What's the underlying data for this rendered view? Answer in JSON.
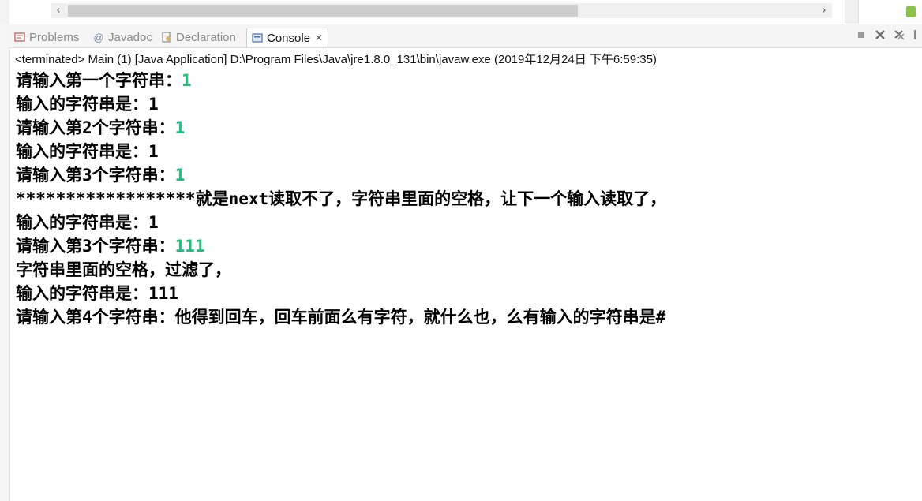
{
  "editor": {
    "hscroll_left_arrow": "‹",
    "hscroll_right_arrow": "›"
  },
  "tabs": [
    {
      "label": "Problems",
      "icon": "problems-icon",
      "active": false
    },
    {
      "label": "Javadoc",
      "icon": "at-icon",
      "active": false
    },
    {
      "label": "Declaration",
      "icon": "declaration-icon",
      "active": false
    },
    {
      "label": "Console",
      "icon": "console-icon",
      "active": true,
      "close": "✕"
    }
  ],
  "toolbar": {
    "icons": [
      "stop-icon",
      "remove-launch-icon",
      "remove-all-terminated-icon"
    ]
  },
  "status": {
    "text": "<terminated> Main (1) [Java Application] D:\\Program Files\\Java\\jre1.8.0_131\\bin\\javaw.exe (2019年12月24日 下午6:59:35)"
  },
  "console": {
    "lines": [
      {
        "prefix": "请输入第一个字符串：",
        "input": "1"
      },
      {
        "prefix": "输入的字符串是：1",
        "input": ""
      },
      {
        "prefix": "请输入第2个字符串：",
        "input": "1"
      },
      {
        "prefix": "输入的字符串是：1",
        "input": ""
      },
      {
        "prefix": "请输入第3个字符串：",
        "input": "1"
      },
      {
        "prefix": "******************就是next读取不了，字符串里面的空格，让下一个输入读取了，",
        "input": ""
      },
      {
        "prefix": "输入的字符串是：1",
        "input": ""
      },
      {
        "prefix": "请输入第3个字符串：",
        "input": "111"
      },
      {
        "prefix": "字符串里面的空格，过滤了，",
        "input": ""
      },
      {
        "prefix": "输入的字符串是：111",
        "input": ""
      },
      {
        "prefix": "请输入第4个字符串：他得到回车，回车前面么有字符，就什么也，么有输入的字符串是#",
        "input": ""
      }
    ]
  },
  "colors": {
    "input_text": "#1bc27a",
    "output_text": "#000000",
    "tab_active_bg": "#ffffff",
    "tabbar_bg": "#f5f5f5"
  }
}
